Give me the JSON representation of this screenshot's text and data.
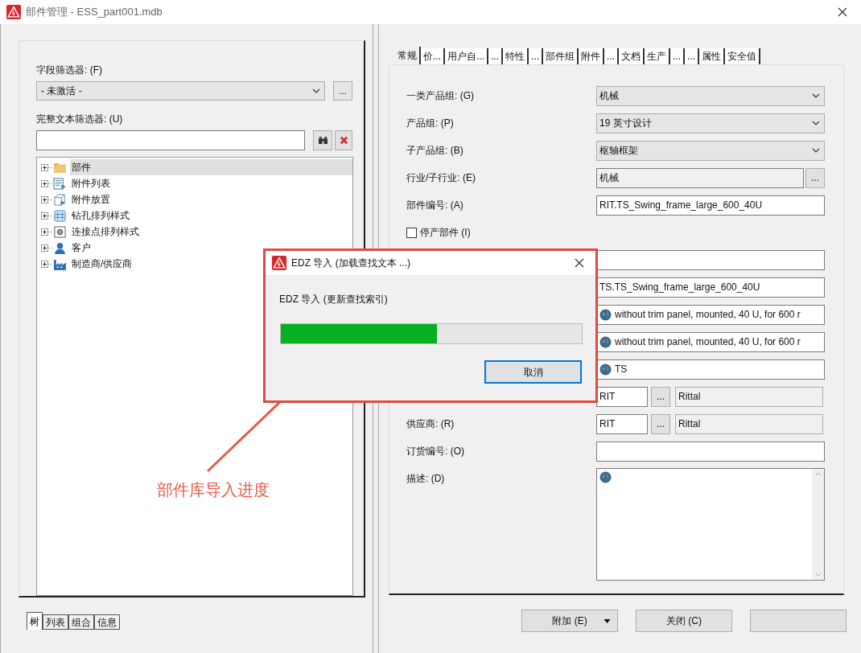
{
  "window": {
    "title": "部件管理 - ESS_part001.mdb"
  },
  "left": {
    "field_filter_label": "字段筛选器: (F)",
    "field_filter_value": "- 未激活 -",
    "more": "...",
    "text_filter_label": "完整文本筛选器: (U)",
    "tree": [
      {
        "label": "部件",
        "kind": "folder",
        "selected": true
      },
      {
        "label": "附件列表",
        "kind": "list",
        "selected": false
      },
      {
        "label": "附件放置",
        "kind": "place",
        "selected": false
      },
      {
        "label": "钻孔排列样式",
        "kind": "drill",
        "selected": false
      },
      {
        "label": "连接点排列样式",
        "kind": "connect",
        "selected": false
      },
      {
        "label": "客户",
        "kind": "person",
        "selected": false
      },
      {
        "label": "制造商/供应商",
        "kind": "factory",
        "selected": false
      }
    ],
    "bottom_tabs": [
      {
        "label": "树",
        "selected": true
      },
      {
        "label": "列表",
        "selected": false
      },
      {
        "label": "组合",
        "selected": false
      },
      {
        "label": "信息",
        "selected": false
      }
    ]
  },
  "right": {
    "tabs": [
      {
        "label": "常规",
        "selected": true
      },
      {
        "label": "价...",
        "selected": false
      },
      {
        "label": "用户自...",
        "selected": false
      },
      {
        "label": "...",
        "selected": false
      },
      {
        "label": "特性",
        "selected": false
      },
      {
        "label": "...",
        "selected": false
      },
      {
        "label": "部件组",
        "selected": false
      },
      {
        "label": "附件",
        "selected": false
      },
      {
        "label": "...",
        "selected": false
      },
      {
        "label": "文档",
        "selected": false
      },
      {
        "label": "生产",
        "selected": false
      },
      {
        "label": "...",
        "selected": false
      },
      {
        "label": "...",
        "selected": false
      },
      {
        "label": "属性",
        "selected": false
      },
      {
        "label": "安全值",
        "selected": false
      }
    ],
    "rows": [
      {
        "kind": "select",
        "label": "一类产品组: (G)",
        "value": "机械"
      },
      {
        "kind": "select",
        "label": "产品组: (P)",
        "value": "19 英寸设计"
      },
      {
        "kind": "select",
        "label": "子产品组: (B)",
        "value": "枢轴框架"
      },
      {
        "kind": "browse",
        "label": "行业/子行业: (E)",
        "value": "机械",
        "button": "..."
      },
      {
        "kind": "text",
        "label": "部件编号: (A)",
        "value": "RIT.TS_Swing_frame_large_600_40U"
      },
      {
        "kind": "checkbox",
        "label": "停产部件 (I)",
        "checked": false
      },
      {
        "kind": "text"
      },
      {
        "kind": "text",
        "value": "TS.TS_Swing_frame_large_600_40U"
      },
      {
        "kind": "globe",
        "value": "without trim panel, mounted, 40 U, for 600 r"
      },
      {
        "kind": "globe",
        "value": "without trim panel, mounted, 40 U, for 600 r"
      },
      {
        "kind": "globe",
        "value": "TS"
      },
      {
        "kind": "pair",
        "value": "RIT",
        "button": "...",
        "name": "Rittal"
      },
      {
        "kind": "pair",
        "label": "供应商: (R)",
        "value": "RIT",
        "button": "...",
        "name": "Rittal"
      },
      {
        "kind": "text",
        "label": "订货编号: (O)"
      },
      {
        "kind": "textarea",
        "label": "描述: (D)"
      }
    ],
    "buttons": [
      {
        "label": "附加 (E)",
        "dropdown": true
      },
      {
        "label": "关闭 (C)",
        "dropdown": false
      }
    ]
  },
  "dialog": {
    "title": "EDZ 导入 (加载查找文本 ...)",
    "message": "EDZ 导入 (更新查找索引)",
    "level": 0.52,
    "button": "取消"
  },
  "annotation": {
    "text": "部件库导入进度"
  }
}
